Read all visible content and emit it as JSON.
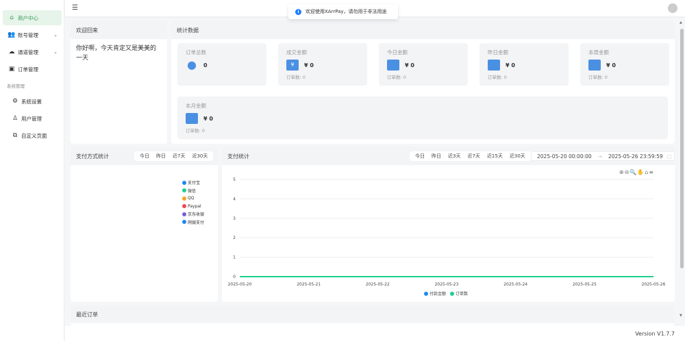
{
  "sidebar": {
    "items": [
      {
        "label": "商户中心",
        "icon": "home-icon",
        "active": true
      },
      {
        "label": "账号管理",
        "icon": "users-icon"
      },
      {
        "label": "通道管理",
        "icon": "cloud-icon"
      },
      {
        "label": "订单管理",
        "icon": "order-icon"
      }
    ],
    "group": "系统管理",
    "sub": [
      {
        "label": "系统设置",
        "icon": "gear-icon"
      },
      {
        "label": "用户管理",
        "icon": "user-icon"
      },
      {
        "label": "自定义页面",
        "icon": "pages-icon"
      }
    ]
  },
  "toast": "欢迎使用XArrPay，请勿用于非法用途",
  "welcome": {
    "title": "欢迎回来",
    "text": "你好啊，今天肯定又是美美的一天"
  },
  "stats": {
    "title": "统计数据",
    "items": [
      {
        "label": "订单总数",
        "value": "0"
      },
      {
        "label": "成交金额",
        "value": "¥ 0",
        "sub": "订单数: 0"
      },
      {
        "label": "今日金额",
        "value": "¥ 0",
        "sub": "订单数: 0"
      },
      {
        "label": "昨日金额",
        "value": "¥ 0",
        "sub": "订单数: 0"
      },
      {
        "label": "本周金额",
        "value": "¥ 0",
        "sub": "订单数: 0"
      },
      {
        "label": "本月金额",
        "value": "¥ 0",
        "sub": "订单数: 0"
      }
    ]
  },
  "paymethod": {
    "title": "支付方式统计",
    "buttons": [
      "今日",
      "昨日",
      "近7天",
      "近30天"
    ],
    "legend": [
      {
        "name": "支付宝",
        "color": "#1e88f0"
      },
      {
        "name": "微信",
        "color": "#1ecf8e"
      },
      {
        "name": "QQ",
        "color": "#f5a623"
      },
      {
        "name": "Paypal",
        "color": "#f0475b"
      },
      {
        "name": "京东收银",
        "color": "#7b5bd6"
      },
      {
        "name": "网银支付",
        "color": "#1e88f0"
      }
    ]
  },
  "paystats": {
    "title": "支付统计",
    "buttons": [
      "今日",
      "昨日",
      "近3天",
      "近7天",
      "近15天",
      "近30天"
    ],
    "start": "2025-05-20 00:00:00",
    "end": "2025-05-26 23:59:59"
  },
  "chart_data": {
    "type": "line",
    "x": [
      "2025-05-20",
      "2025-05-21",
      "2025-05-22",
      "2025-05-23",
      "2025-05-24",
      "2025-05-25",
      "2025-05-26"
    ],
    "yticks": [
      "0",
      "1",
      "2",
      "3",
      "4",
      "5"
    ],
    "ylim": [
      0,
      5
    ],
    "series": [
      {
        "name": "付款金额",
        "color": "#1e88f0",
        "values": [
          0,
          0,
          0,
          0,
          0,
          0,
          0
        ]
      },
      {
        "name": "订单数",
        "color": "#1ecf8e",
        "values": [
          0,
          0,
          0,
          0,
          0,
          0,
          0
        ]
      }
    ]
  },
  "recent": {
    "title": "最近订单"
  },
  "footer": {
    "version": "Version V1.7.7"
  }
}
